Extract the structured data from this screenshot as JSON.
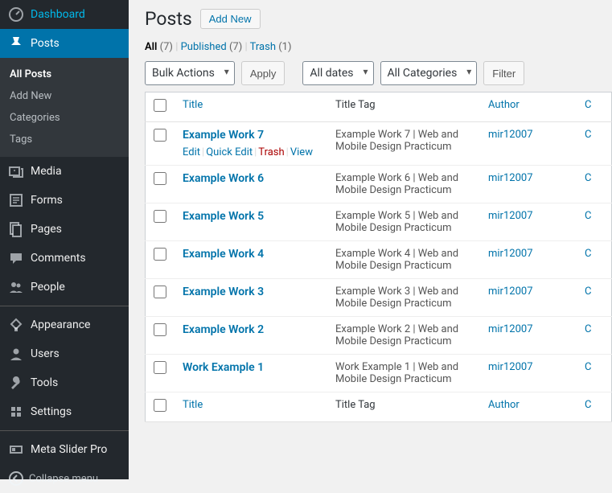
{
  "sidebar": {
    "items": [
      {
        "label": "Dashboard",
        "icon": "dashboard"
      },
      {
        "label": "Posts",
        "icon": "pin",
        "current": true,
        "submenu": [
          {
            "label": "All Posts",
            "active": true
          },
          {
            "label": "Add New"
          },
          {
            "label": "Categories"
          },
          {
            "label": "Tags"
          }
        ]
      },
      {
        "label": "Media",
        "icon": "media"
      },
      {
        "label": "Forms",
        "icon": "forms"
      },
      {
        "label": "Pages",
        "icon": "pages"
      },
      {
        "label": "Comments",
        "icon": "comments"
      },
      {
        "label": "People",
        "icon": "people"
      },
      {
        "label": "Appearance",
        "icon": "appearance",
        "sepBefore": true
      },
      {
        "label": "Users",
        "icon": "users"
      },
      {
        "label": "Tools",
        "icon": "tools"
      },
      {
        "label": "Settings",
        "icon": "settings"
      },
      {
        "label": "Meta Slider Pro",
        "icon": "slider",
        "sepBefore": true
      }
    ],
    "collapse_label": "Collapse menu"
  },
  "header": {
    "title": "Posts",
    "add_new": "Add New"
  },
  "views": {
    "all_label": "All",
    "all_count": "(7)",
    "published_label": "Published",
    "published_count": "(7)",
    "trash_label": "Trash",
    "trash_count": "(1)"
  },
  "filters": {
    "bulk": "Bulk Actions",
    "apply": "Apply",
    "dates": "All dates",
    "categories": "All Categories",
    "filter": "Filter"
  },
  "columns": {
    "title": "Title",
    "title_tag": "Title Tag",
    "author": "Author",
    "cut": "C"
  },
  "row_actions": {
    "edit": "Edit",
    "quick_edit": "Quick Edit",
    "trash": "Trash",
    "view": "View"
  },
  "rows": [
    {
      "title": "Example Work 7",
      "tag": "Example Work 7 | Web and Mobile Design Practicum",
      "author": "mir12007",
      "show_actions": true
    },
    {
      "title": "Example Work 6",
      "tag": "Example Work 6 | Web and Mobile Design Practicum",
      "author": "mir12007"
    },
    {
      "title": "Example Work 5",
      "tag": "Example Work 5 | Web and Mobile Design Practicum",
      "author": "mir12007"
    },
    {
      "title": "Example Work 4",
      "tag": "Example Work 4 | Web and Mobile Design Practicum",
      "author": "mir12007"
    },
    {
      "title": "Example Work 3",
      "tag": "Example Work 3 | Web and Mobile Design Practicum",
      "author": "mir12007"
    },
    {
      "title": "Example Work 2",
      "tag": "Example Work 2 | Web and Mobile Design Practicum",
      "author": "mir12007"
    },
    {
      "title": "Work Example 1",
      "tag": "Work Example 1 | Web and Mobile Design Practicum",
      "author": "mir12007"
    }
  ]
}
